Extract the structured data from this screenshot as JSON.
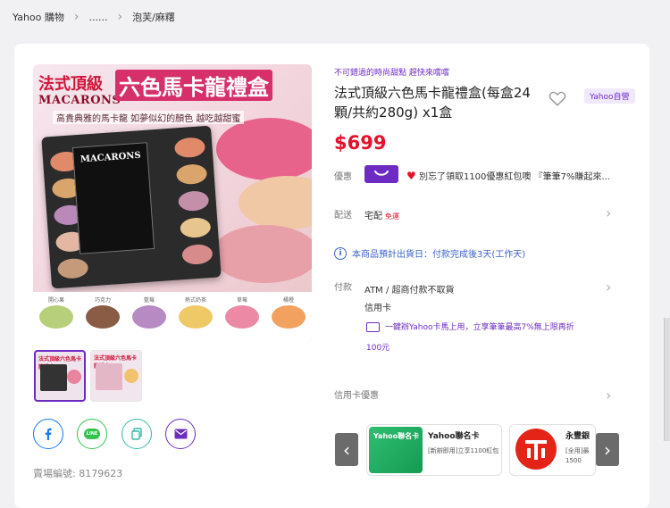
{
  "breadcrumb": {
    "items": [
      "Yahoo 購物",
      "......",
      "泡芙/麻糬"
    ]
  },
  "gallery": {
    "image_text": {
      "title_prefix": "法式頂級",
      "title_main": "六色馬卡龍禮盒",
      "title_en": "MACARONS",
      "subtitle": "高貴典雅的馬卡龍  如夢似幻的顏色  越吃越甜蜜",
      "box_label": "MACARONS",
      "flavors": [
        "開心果",
        "巧克力",
        "藍莓",
        "熱式奶茶",
        "草莓",
        "橘橙"
      ]
    },
    "thumbnails": [
      {
        "title": "法式頂級六色馬卡龍禮盒",
        "selected": true
      },
      {
        "title": "法式頂級六色馬卡龍禮盒",
        "selected": false
      }
    ]
  },
  "share": {
    "icons": [
      "facebook-icon",
      "line-icon",
      "copy-icon",
      "mail-icon"
    ],
    "line_label": "LINE"
  },
  "sku": "賣場編號: 8179623",
  "product": {
    "promo_text": "不可錯過的時尚甜點 趕快來嚐嚐",
    "title": "法式頂級六色馬卡龍禮盒(每盒24顆/共約280g) x1盒",
    "store_badge": "Yahoo自營",
    "price": "$699"
  },
  "rows": {
    "coupon": {
      "label": "優惠",
      "text": "別忘了領取1100優惠紅包噢 『筆筆7%賺起來..."
    },
    "delivery": {
      "label": "配送",
      "method": "宅配",
      "free_tag": "免運"
    },
    "shipping_info": "本商品預計出貨日：付款完成後3天(工作天)",
    "payment": {
      "label": "付款",
      "options": [
        "ATM / 超商付款不取貨",
        "信用卡"
      ],
      "card_promo": "一鍵辦Yahoo卡馬上用，立享筆筆最高7%無上限再折",
      "card_promo_amount": "100元"
    },
    "credit_card": {
      "label": "信用卡優惠"
    }
  },
  "credit_cards": [
    {
      "name": "Yahoo聯名卡",
      "desc": "[新辦即用]立享1100紅包"
    },
    {
      "name": "永豐銀",
      "desc": "[全用]最1500"
    }
  ],
  "colors": {
    "accent_purple": "#6e2bc4",
    "price_red": "#e3112c",
    "info_blue": "#3d63c9"
  }
}
